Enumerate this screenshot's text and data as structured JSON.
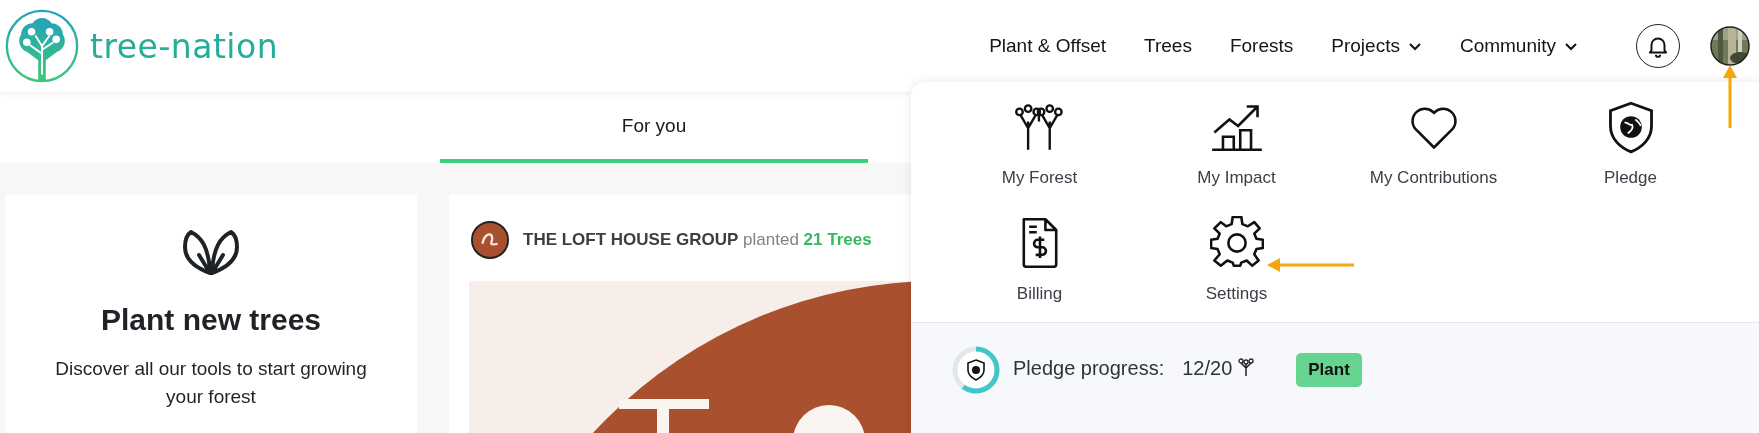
{
  "header": {
    "logo_text": "tree-nation",
    "nav": [
      {
        "label": "Plant & Offset",
        "has_menu": false
      },
      {
        "label": "Trees",
        "has_menu": false
      },
      {
        "label": "Forests",
        "has_menu": false
      },
      {
        "label": "Projects",
        "has_menu": true
      },
      {
        "label": "Community",
        "has_menu": true
      }
    ]
  },
  "tabs": [
    {
      "label": "For you",
      "selected": true
    }
  ],
  "promo_card": {
    "title": "Plant new trees",
    "text": "Discover all our tools to start growing your forest"
  },
  "post": {
    "author": "THE LOFT HOUSE GROUP",
    "verb": "planted",
    "count": "21 Trees"
  },
  "account_menu": {
    "items": [
      {
        "label": "My Forest"
      },
      {
        "label": "My Impact"
      },
      {
        "label": "My Contributions"
      },
      {
        "label": "Pledge"
      },
      {
        "label": "Billing"
      },
      {
        "label": "Settings"
      }
    ],
    "pledge_progress": {
      "label": "Pledge progress:",
      "value": "12/20",
      "level": 0.6,
      "button": "Plant"
    }
  }
}
